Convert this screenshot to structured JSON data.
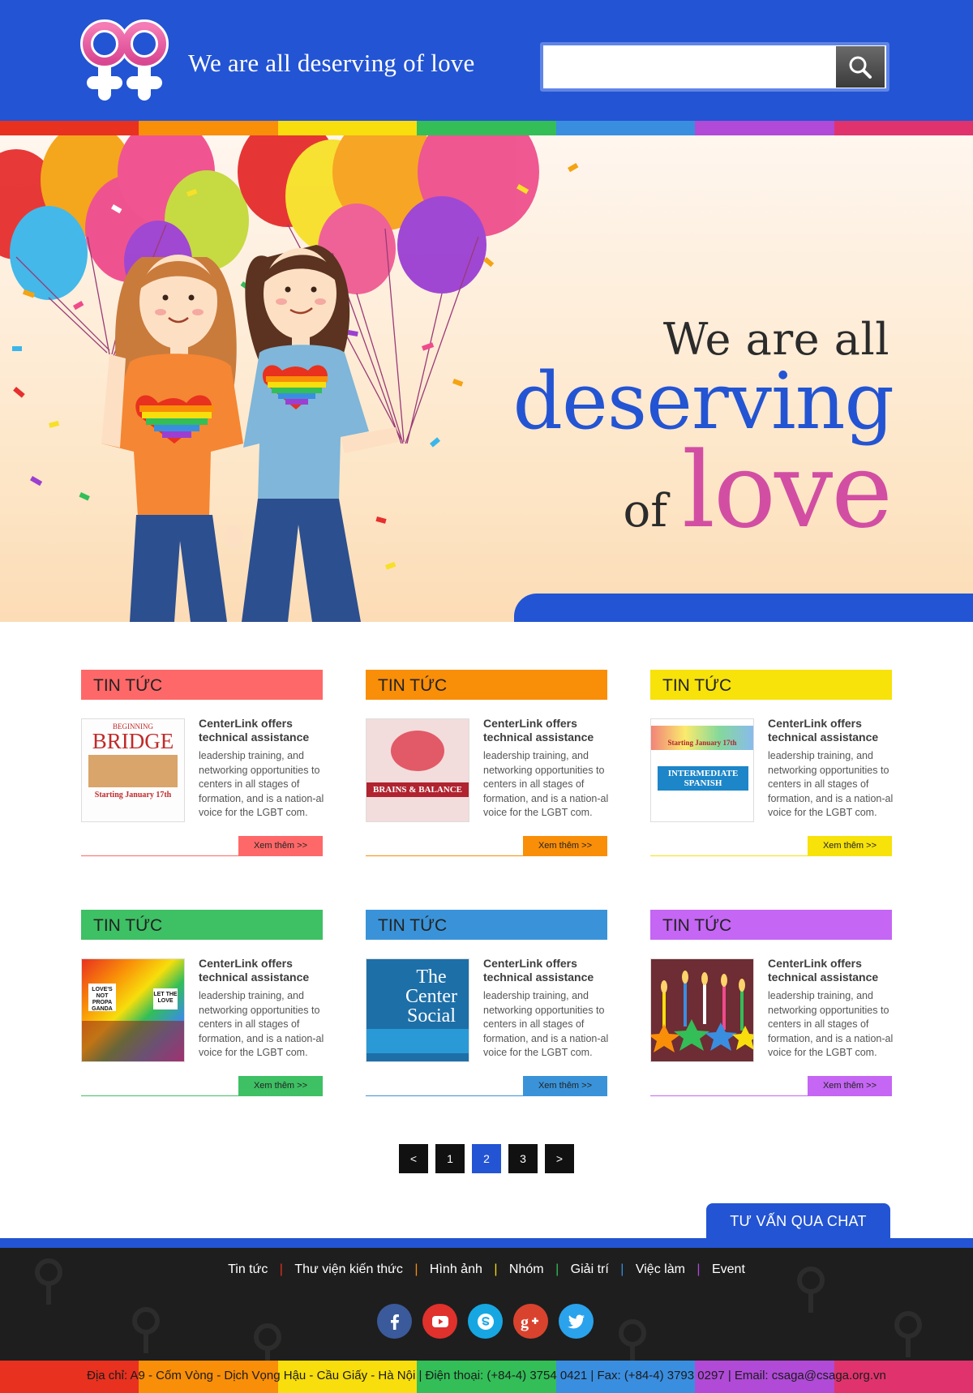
{
  "header": {
    "tagline": "We are all deserving of love",
    "search": {
      "placeholder": "",
      "value": ""
    }
  },
  "colors": {
    "primary": "#2354d3",
    "rainbow": [
      "#e8311f",
      "#f98e08",
      "#f7de0c",
      "#33be58",
      "#3a8ee0",
      "#b04ad7",
      "#e0336e"
    ]
  },
  "hero": {
    "line1": "We are all",
    "line2": "deserving",
    "line3_of": "of",
    "line3_love": "love"
  },
  "news": {
    "cards": [
      {
        "heading": "TIN TỨC",
        "title": "CenterLink offers technical assistance",
        "text": "leadership training, and networking opportunities to centers in all stages of formation, and is a nation-al voice for the LGBT com.",
        "more": "Xem thêm >>",
        "accent": "#ff6868",
        "thumb": {
          "type": "poster",
          "line1": "BEGINNING",
          "line2": "BRIDGE",
          "line3": "Starting January 17th"
        }
      },
      {
        "heading": "TIN TỨC",
        "title": "CenterLink offers technical assistance",
        "text": "leadership training, and networking opportunities to centers in all stages of formation, and is a nation-al voice for the LGBT com.",
        "more": "Xem thêm >>",
        "accent": "#f98e08",
        "thumb": {
          "type": "poster",
          "line1": "",
          "line2": "BRAINS & BALANCE",
          "line3": ""
        }
      },
      {
        "heading": "TIN TỨC",
        "title": "CenterLink offers technical assistance",
        "text": "leadership training, and networking opportunities to centers in all stages of formation, and is a nation-al voice for the LGBT com.",
        "more": "Xem thêm >>",
        "accent": "#f7e20a",
        "thumb": {
          "type": "poster",
          "line1": "Starting January 17th",
          "line2": "INTERMEDIATE SPANISH",
          "line3": ""
        }
      },
      {
        "heading": "TIN TỨC",
        "title": "CenterLink offers technical assistance",
        "text": "leadership training, and networking opportunities to centers in all stages of formation, and is a nation-al voice for the LGBT com.",
        "more": "Xem thêm >>",
        "accent": "#3ec064",
        "thumb": {
          "type": "photo"
        }
      },
      {
        "heading": "TIN TỨC",
        "title": "CenterLink offers technical assistance",
        "text": "leadership training, and networking opportunities to centers in all stages of formation, and is a nation-al voice for the LGBT com.",
        "more": "Xem thêm >>",
        "accent": "#3a93d8",
        "thumb": {
          "type": "poster",
          "line1": "The Center Social",
          "line2": "",
          "line3": ""
        }
      },
      {
        "heading": "TIN TỨC",
        "title": "CenterLink offers technical assistance",
        "text": "leadership training, and networking opportunities to centers in all stages of formation, and is a nation-al voice for the LGBT com.",
        "more": "Xem thêm >>",
        "accent": "#c566f4",
        "thumb": {
          "type": "candles"
        }
      }
    ]
  },
  "pagination": {
    "prev": "<",
    "pages": [
      "1",
      "2",
      "3"
    ],
    "current": "2",
    "next": ">"
  },
  "chat": {
    "label": "TƯ VẤN QUA CHAT"
  },
  "footer": {
    "nav": [
      "Tin tức",
      "Thư viện kiến thức",
      "Hình ảnh",
      "Nhóm",
      "Giải trí",
      "Việc làm",
      "Event"
    ],
    "separators": [
      "#e8311f",
      "#f98e08",
      "#f7de0c",
      "#33be58",
      "#3a8ee0",
      "#b04ad7"
    ],
    "socials": [
      {
        "icon": "facebook-icon",
        "color": "#3b5a9b"
      },
      {
        "icon": "youtube-icon",
        "color": "#e0312c"
      },
      {
        "icon": "skype-icon",
        "color": "#16a7e3"
      },
      {
        "icon": "google-plus-icon",
        "color": "#d9432e"
      },
      {
        "icon": "twitter-icon",
        "color": "#2aa3ec"
      }
    ],
    "address": "Địa chỉ: A9 - Cốm Vòng - Dịch Vọng Hậu - Cầu Giấy - Hà Nội  |  Điện thoại: (+84-4) 3754 0421  |  Fax: (+84-4) 3793 0297  |  Email: csaga@csaga.org.vn"
  }
}
